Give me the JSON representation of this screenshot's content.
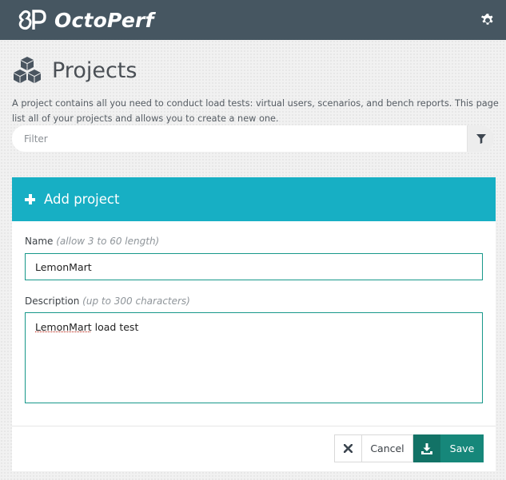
{
  "app": {
    "brand_name": "OctoPerf",
    "header_color": "#465661"
  },
  "page": {
    "title": "Projects",
    "description": "A project contains all you need to conduct load tests: virtual users, scenarios, and bench reports. This page list all of your projects and allows you to create a new one."
  },
  "filter": {
    "placeholder": "Filter",
    "value": ""
  },
  "add_project": {
    "title": "Add project",
    "accent_color": "#17afc4",
    "name_label": "Name",
    "name_hint": "(allow 3 to 60 length)",
    "name_value": "LemonMart",
    "description_label": "Description",
    "description_hint": "(up to 300 characters)",
    "description_value_word1": "LemonMart",
    "description_value_rest": " load test",
    "cancel_label": "Cancel",
    "save_label": "Save",
    "save_color": "#16877a"
  },
  "icons": {
    "settings": "gear-icon",
    "page": "cubes-icon",
    "filter": "funnel-icon",
    "add": "plus-icon",
    "cancel": "close-icon",
    "save": "download-icon"
  }
}
